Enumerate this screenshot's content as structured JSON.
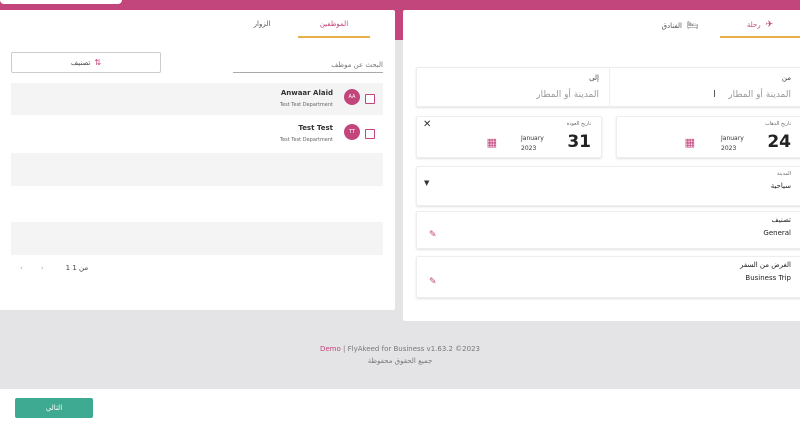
{
  "employees_panel": {
    "tabs": [
      {
        "label": "الموظفين",
        "active": true
      },
      {
        "label": "الزوار",
        "active": false
      }
    ],
    "sort_button_label": "تصنيف",
    "search_placeholder": "البحث عن موظف",
    "employees": [
      {
        "initials": "AA",
        "name": "Anwaar Alaid",
        "department": "Test Test Department",
        "checked": false
      },
      {
        "initials": "TT",
        "name": "Test Test",
        "department": "Test Test Department",
        "checked": false
      }
    ],
    "pagination": {
      "text": "1 من 1",
      "prev_icon": "chevron-left-icon",
      "next_icon": "chevron-right-icon"
    }
  },
  "trip_panel": {
    "tabs": [
      {
        "label": "رحلة",
        "icon": "plane-icon",
        "active": true
      },
      {
        "label": "الفنادق",
        "icon": "bed-icon",
        "active": false
      }
    ],
    "route": {
      "from_label": "من",
      "from_placeholder": "المدينة أو المطار",
      "to_label": "إلى",
      "to_placeholder": "المدينة أو المطار"
    },
    "departure": {
      "label": "تاريخ الذهاب",
      "day": "24",
      "month": "January",
      "year": "2023"
    },
    "return": {
      "label": "تاريخ العودة",
      "day": "31",
      "month": "January",
      "year": "2023"
    },
    "trip_purpose": {
      "label": "المدينة",
      "value": "سياحية"
    },
    "classification": {
      "label": "تصنيف",
      "value": "General"
    },
    "travel_reason": {
      "label": "الغرض من السفر",
      "value": "Business Trip"
    }
  },
  "footer": {
    "brand": "Demo",
    "version_text": "| FlyAkeed for Business v1.63.2 ©2023",
    "rights": "جميع الحقوق محفوظة"
  },
  "actions": {
    "next_label": "التالي"
  },
  "colors": {
    "accent": "#c2457b",
    "tab_underline": "#e8b04a",
    "next_button": "#3daa91",
    "background": "#e4e4e6"
  }
}
